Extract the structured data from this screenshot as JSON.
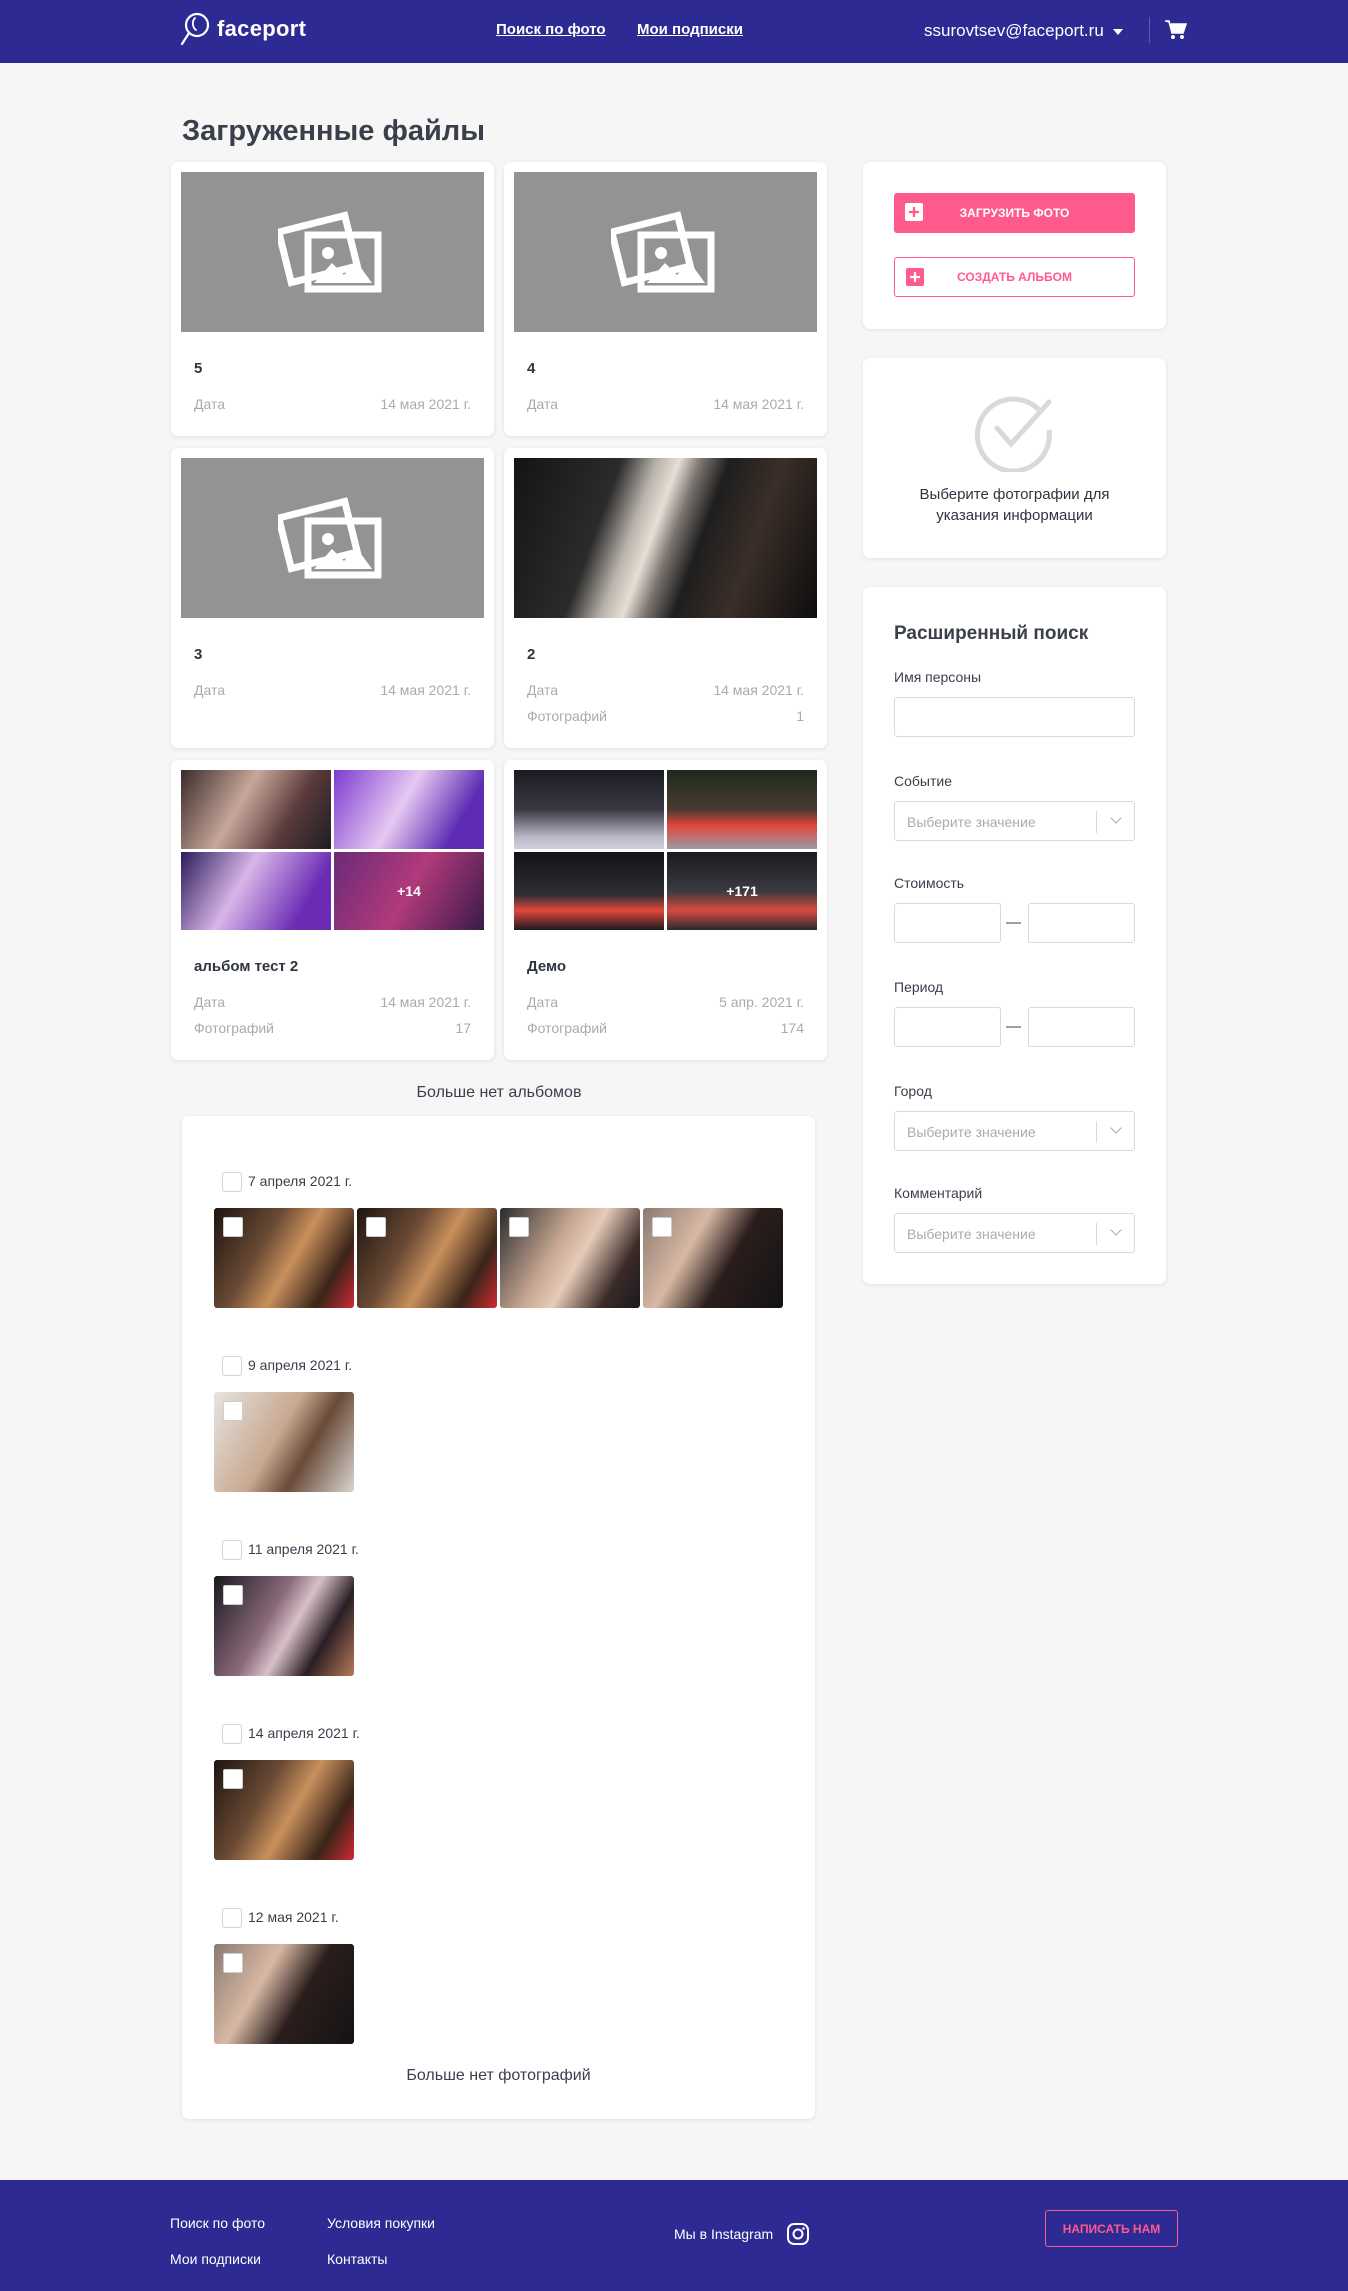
{
  "header": {
    "brand": "faceport",
    "nav": [
      "Поиск по фото",
      "Мои подписки"
    ],
    "user_email": "ssurovtsev@faceport.ru"
  },
  "page_title": "Загруженные файлы",
  "albums": [
    {
      "title": "5",
      "date_label": "Дата",
      "date": "14 мая 2021 г."
    },
    {
      "title": "4",
      "date_label": "Дата",
      "date": "14 мая 2021 г."
    },
    {
      "title": "3",
      "date_label": "Дата",
      "date": "14 мая 2021 г."
    },
    {
      "title": "2",
      "date_label": "Дата",
      "date": "14 мая 2021 г.",
      "count_label": "Фотографий",
      "count": "1"
    },
    {
      "title": "альбом тест 2",
      "date_label": "Дата",
      "date": "14 мая 2021 г.",
      "count_label": "Фотографий",
      "count": "17",
      "more": "+14"
    },
    {
      "title": "Демо",
      "date_label": "Дата",
      "date": "5 апр. 2021 г.",
      "count_label": "Фотографий",
      "count": "174",
      "more": "+171"
    }
  ],
  "no_more_albums": "Больше нет альбомов",
  "photo_groups": [
    {
      "date": "7 апреля 2021 г.",
      "count": 4
    },
    {
      "date": "9 апреля 2021 г.",
      "count": 1
    },
    {
      "date": "11 апреля 2021 г.",
      "count": 1
    },
    {
      "date": "14 апреля 2021 г.",
      "count": 1
    },
    {
      "date": "12 мая 2021 г.",
      "count": 1
    }
  ],
  "no_more_photos": "Больше нет фотографий",
  "sidebar": {
    "upload_label": "Загрузить фото",
    "create_album_label": "Создать альбом",
    "select_hint": "Выберите фотографии для указания информации",
    "search_title": "Расширенный поиск",
    "person_label": "Имя персоны",
    "event_label": "Событие",
    "price_label": "Стоимость",
    "period_label": "Период",
    "city_label": "Город",
    "comment_label": "Комментарий",
    "select_placeholder": "Выберите значение",
    "range_dash": "—"
  },
  "footer": {
    "links": [
      "Поиск по фото",
      "Мои подписки",
      "Условия покупки",
      "Контакты"
    ],
    "instagram": "Мы в Instagram",
    "contact_button": "Написать нам"
  },
  "colors": {
    "brand": "#2d2a94",
    "accent": "#ff5a8c"
  }
}
